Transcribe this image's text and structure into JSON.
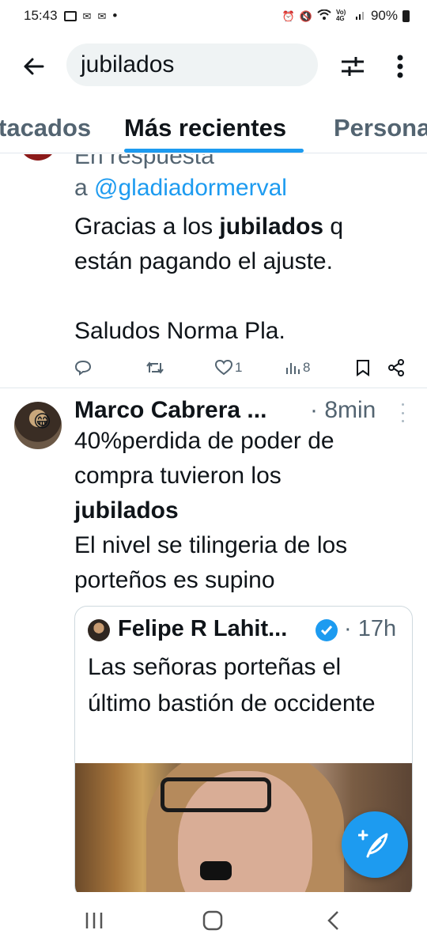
{
  "status_bar": {
    "time": "15:43",
    "notif_icons": [
      "image-icon",
      "mail-icon",
      "mail-icon"
    ],
    "dot": "•",
    "battery": "90%",
    "lte_label": "Vo) 4G"
  },
  "search": {
    "query": "jubilados"
  },
  "tabs": [
    {
      "label": "Destacados",
      "visible_label": "tacados"
    },
    {
      "label": "Más recientes"
    },
    {
      "label": "Personas",
      "visible_label": "Persona"
    }
  ],
  "tweet1": {
    "reply_prefix_cut": "En respuesta",
    "reply_a": "a ",
    "reply_handle": "@gladiadormerval",
    "body_pre": "Gracias a los ",
    "body_bold": "jubilados",
    "body_post": " q",
    "body_line2": "están pagando el ajuste.",
    "body_line3": "Saludos Norma Pla.",
    "likes": "1",
    "views": "8"
  },
  "tweet2": {
    "name": "Marco Cabrera ...",
    "time": "· 8min",
    "body_line1": "40%perdida de poder de",
    "body_line2": "compra tuvieron los",
    "body_bold": "jubilados",
    "body_line4": "El nivel se tilingeria de los",
    "body_line5": "porteños es supino",
    "quote": {
      "name": "Felipe R Lahit...",
      "time": "· 17h",
      "body": "Las señoras porteñas el último bastión de occidente"
    }
  },
  "colors": {
    "accent": "#1d9bf0",
    "text": "#0f1419",
    "secondary": "#536471"
  }
}
